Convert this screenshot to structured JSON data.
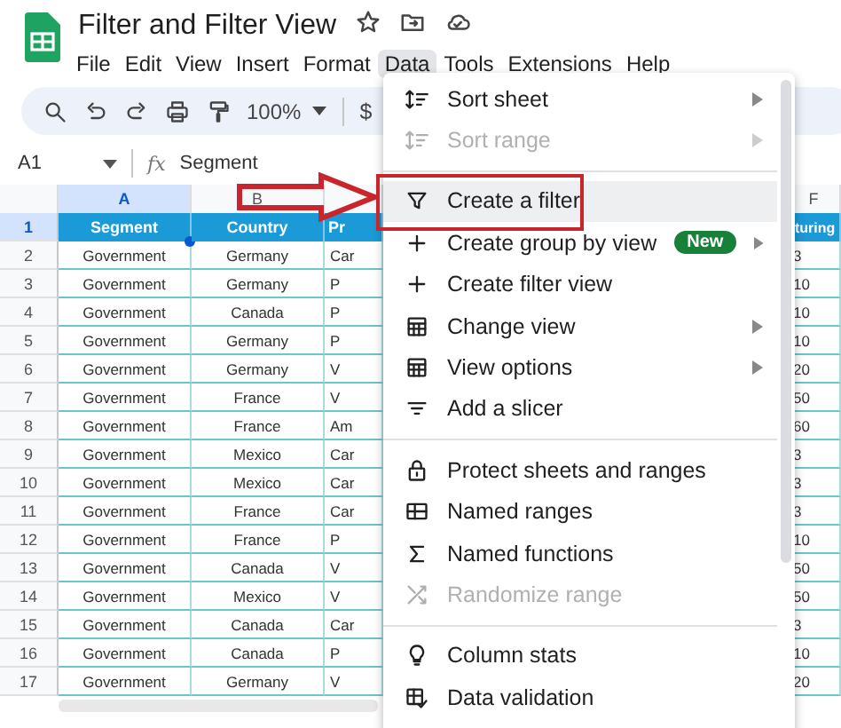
{
  "document": {
    "title": "Filter and Filter View"
  },
  "menubar": [
    {
      "label": "File",
      "selected": false
    },
    {
      "label": "Edit",
      "selected": false
    },
    {
      "label": "View",
      "selected": false
    },
    {
      "label": "Insert",
      "selected": false
    },
    {
      "label": "Format",
      "selected": false
    },
    {
      "label": "Data",
      "selected": true
    },
    {
      "label": "Tools",
      "selected": false
    },
    {
      "label": "Extensions",
      "selected": false
    },
    {
      "label": "Help",
      "selected": false
    }
  ],
  "toolbar": {
    "zoom": "100%",
    "currency": "$"
  },
  "formula_bar": {
    "cell": "A1",
    "fx": "fx",
    "formula": "Segment"
  },
  "sheet": {
    "columns": [
      {
        "label": "A",
        "selected": true
      },
      {
        "label": "B",
        "selected": false
      },
      {
        "label": "F",
        "selected": false
      }
    ],
    "header_row": {
      "number": "1",
      "selected": true,
      "cells": [
        "Segment",
        "Country",
        "Pr",
        "turing"
      ]
    },
    "rows": [
      {
        "number": "2",
        "cells": [
          "Government",
          "Germany",
          "Car",
          "3"
        ]
      },
      {
        "number": "3",
        "cells": [
          "Government",
          "Germany",
          "P",
          "10"
        ]
      },
      {
        "number": "4",
        "cells": [
          "Government",
          "Canada",
          "P",
          "10"
        ]
      },
      {
        "number": "5",
        "cells": [
          "Government",
          "Germany",
          "P",
          "10"
        ]
      },
      {
        "number": "6",
        "cells": [
          "Government",
          "Germany",
          "V",
          "20"
        ]
      },
      {
        "number": "7",
        "cells": [
          "Government",
          "France",
          "V",
          "50"
        ]
      },
      {
        "number": "8",
        "cells": [
          "Government",
          "France",
          "Am",
          "60"
        ]
      },
      {
        "number": "9",
        "cells": [
          "Government",
          "Mexico",
          "Car",
          "3"
        ]
      },
      {
        "number": "10",
        "cells": [
          "Government",
          "Mexico",
          "Car",
          "3"
        ]
      },
      {
        "number": "11",
        "cells": [
          "Government",
          "France",
          "Car",
          "3"
        ]
      },
      {
        "number": "12",
        "cells": [
          "Government",
          "France",
          "P",
          "10"
        ]
      },
      {
        "number": "13",
        "cells": [
          "Government",
          "Canada",
          "V",
          "50"
        ]
      },
      {
        "number": "14",
        "cells": [
          "Government",
          "Mexico",
          "V",
          "50"
        ]
      },
      {
        "number": "15",
        "cells": [
          "Government",
          "Canada",
          "Car",
          "3"
        ]
      },
      {
        "number": "16",
        "cells": [
          "Government",
          "Canada",
          "P",
          "10"
        ]
      },
      {
        "number": "17",
        "cells": [
          "Government",
          "Germany",
          "V",
          "20"
        ]
      }
    ]
  },
  "data_menu": [
    {
      "kind": "item",
      "label": "Sort sheet",
      "disabled": false,
      "highlighted": false,
      "submenu": true
    },
    {
      "kind": "item",
      "label": "Sort range",
      "disabled": true,
      "highlighted": false,
      "submenu": true
    },
    {
      "kind": "divider"
    },
    {
      "kind": "item",
      "label": "Create a filter",
      "disabled": false,
      "highlighted": true,
      "submenu": false
    },
    {
      "kind": "item",
      "label": "Create group by view",
      "disabled": false,
      "highlighted": false,
      "submenu": true,
      "badge": "New"
    },
    {
      "kind": "item",
      "label": "Create filter view",
      "disabled": false,
      "highlighted": false,
      "submenu": false
    },
    {
      "kind": "item",
      "label": "Change view",
      "disabled": false,
      "highlighted": false,
      "submenu": true
    },
    {
      "kind": "item",
      "label": "View options",
      "disabled": false,
      "highlighted": false,
      "submenu": true
    },
    {
      "kind": "item",
      "label": "Add a slicer",
      "disabled": false,
      "highlighted": false,
      "submenu": false
    },
    {
      "kind": "divider"
    },
    {
      "kind": "item",
      "label": "Protect sheets and ranges",
      "disabled": false,
      "highlighted": false,
      "submenu": false
    },
    {
      "kind": "item",
      "label": "Named ranges",
      "disabled": false,
      "highlighted": false,
      "submenu": false
    },
    {
      "kind": "item",
      "label": "Named functions",
      "disabled": false,
      "highlighted": false,
      "submenu": false
    },
    {
      "kind": "item",
      "label": "Randomize range",
      "disabled": true,
      "highlighted": false,
      "submenu": false
    },
    {
      "kind": "divider"
    },
    {
      "kind": "item",
      "label": "Column stats",
      "disabled": false,
      "highlighted": false,
      "submenu": false
    },
    {
      "kind": "item",
      "label": "Data validation",
      "disabled": false,
      "highlighted": false,
      "submenu": false
    }
  ]
}
